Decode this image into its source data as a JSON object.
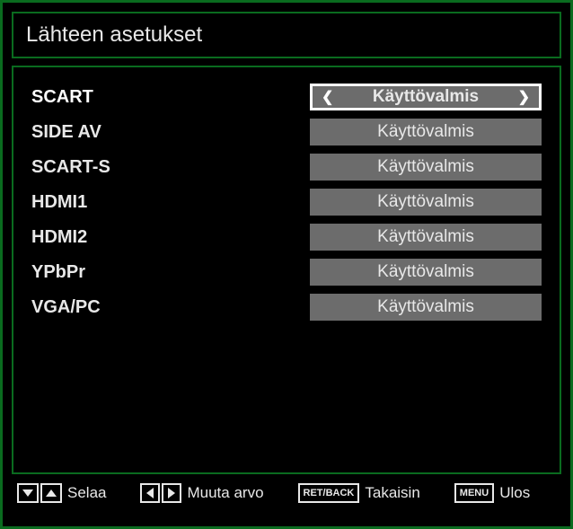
{
  "title": "Lähteen asetukset",
  "rows": [
    {
      "label": "SCART",
      "value": "Käyttövalmis",
      "selected": true
    },
    {
      "label": "SIDE AV",
      "value": "Käyttövalmis",
      "selected": false
    },
    {
      "label": "SCART-S",
      "value": "Käyttövalmis",
      "selected": false
    },
    {
      "label": "HDMI1",
      "value": "Käyttövalmis",
      "selected": false
    },
    {
      "label": "HDMI2",
      "value": "Käyttövalmis",
      "selected": false
    },
    {
      "label": "YPbPr",
      "value": "Käyttövalmis",
      "selected": false
    },
    {
      "label": "VGA/PC",
      "value": "Käyttövalmis",
      "selected": false
    }
  ],
  "footer": {
    "scroll": "Selaa",
    "change": "Muuta arvo",
    "back_key": "RET/BACK",
    "back": "Takaisin",
    "menu_key": "MENU",
    "exit": "Ulos"
  }
}
